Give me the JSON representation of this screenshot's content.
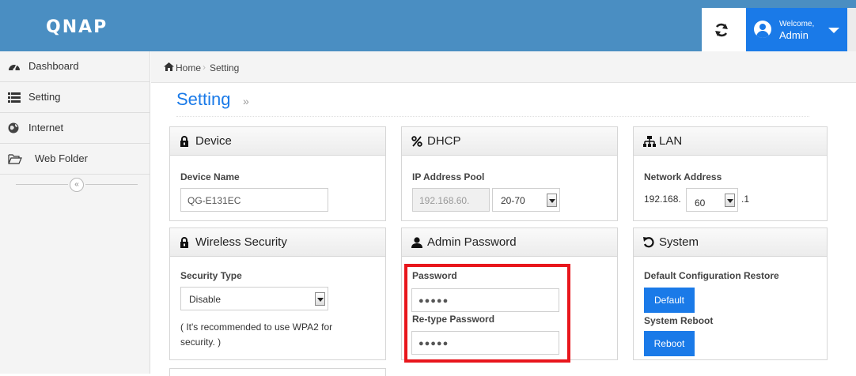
{
  "header": {
    "logo": "QNAP",
    "welcome": "Welcome,",
    "username": "Admin"
  },
  "sidebar": {
    "items": [
      {
        "label": "Dashboard",
        "icon": "dashboard-icon"
      },
      {
        "label": "Setting",
        "icon": "list-icon"
      },
      {
        "label": "Internet",
        "icon": "globe-icon"
      },
      {
        "label": "Web Folder",
        "icon": "folder-open-icon"
      }
    ],
    "collapse": "«"
  },
  "breadcrumb": {
    "home": "Home",
    "separator": "›",
    "current": "Setting"
  },
  "page": {
    "title": "Setting",
    "title_arrow": "»"
  },
  "device": {
    "title": "Device",
    "field_label": "Device Name",
    "field_value": "QG-E131EC"
  },
  "dhcp": {
    "title": "DHCP",
    "field_label": "IP Address Pool",
    "prefix": "192.168.60.",
    "range": "20-70"
  },
  "lan": {
    "title": "LAN",
    "field_label": "Network Address",
    "prefix": "192.168.",
    "octet": "60",
    "suffix": ".1"
  },
  "wireless": {
    "title": "Wireless Security",
    "field_label": "Security Type",
    "selected": "Disable",
    "note_line1": "( It's recommended to use WPA2 for",
    "note_line2": "security. )"
  },
  "admin_password": {
    "title": "Admin Password",
    "password_label": "Password",
    "password_value": "●●●●●",
    "retype_label": "Re-type Password",
    "retype_value": "●●●●●"
  },
  "system": {
    "title": "System",
    "restore_label": "Default Configuration Restore",
    "default_button": "Default",
    "reboot_label": "System Reboot",
    "reboot_button": "Reboot"
  },
  "colors": {
    "header_bg": "#4a8ec2",
    "accent": "#1a7ae8",
    "highlight": "#e8161c"
  }
}
